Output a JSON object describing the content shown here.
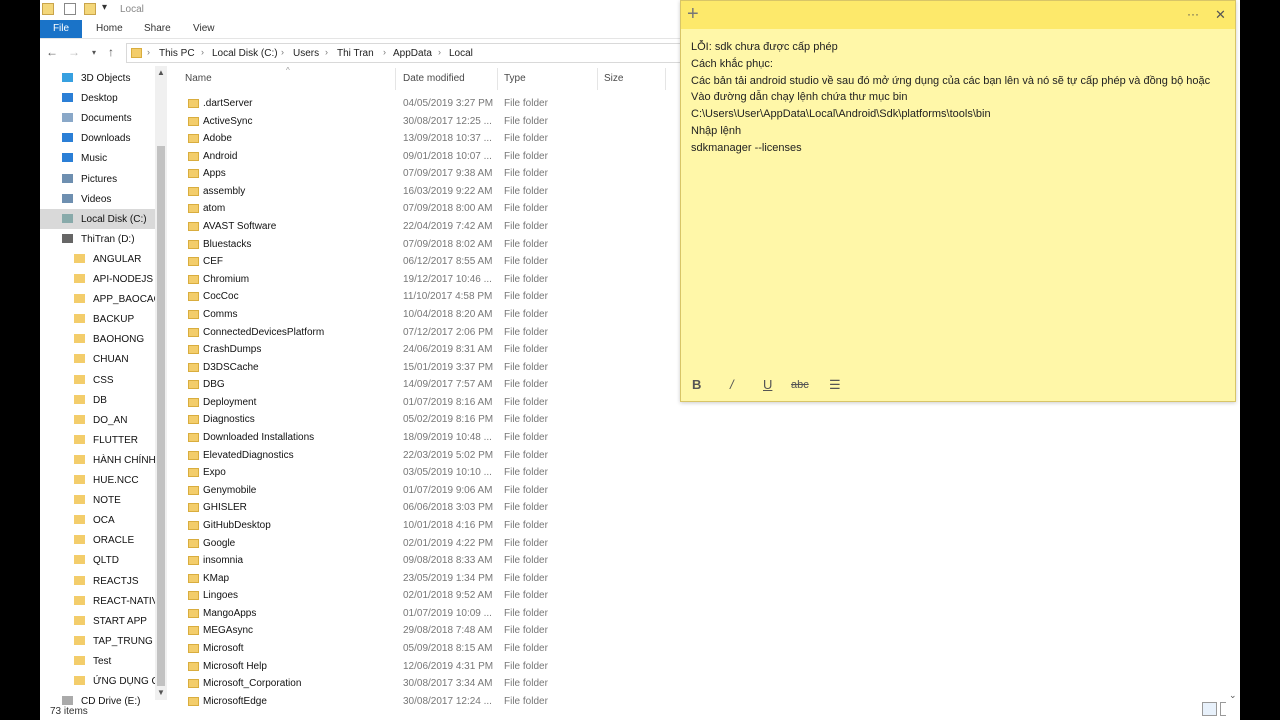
{
  "window": {
    "title": "Local"
  },
  "ribbon": {
    "tabs": [
      "File",
      "Home",
      "Share",
      "View"
    ]
  },
  "address": {
    "crumbs": [
      "This PC",
      "Local Disk (C:)",
      "Users",
      "Thi Tran",
      "AppData",
      "Local"
    ]
  },
  "nav": {
    "items": [
      {
        "label": "3D Objects",
        "icon": "cube-icon",
        "color": "#37a0e0"
      },
      {
        "label": "Desktop",
        "icon": "desktop-icon",
        "color": "#2b7fd6"
      },
      {
        "label": "Documents",
        "icon": "document-icon",
        "color": "#8aa8c8"
      },
      {
        "label": "Downloads",
        "icon": "download-icon",
        "color": "#2b7fd6"
      },
      {
        "label": "Music",
        "icon": "music-icon",
        "color": "#2b7fd6"
      },
      {
        "label": "Pictures",
        "icon": "pictures-icon",
        "color": "#6e8fb0"
      },
      {
        "label": "Videos",
        "icon": "video-icon",
        "color": "#6e8fb0"
      },
      {
        "label": "Local Disk (C:)",
        "icon": "drive-icon",
        "color": "#8aa"
      },
      {
        "label": "ThiTran (D:)",
        "icon": "drive-icon",
        "color": "#666"
      },
      {
        "label": "ANGULAR",
        "icon": "folder-icon",
        "color": "#f3cd6b"
      },
      {
        "label": "API-NODEJS",
        "icon": "folder-icon",
        "color": "#f3cd6b"
      },
      {
        "label": "APP_BAOCAO",
        "icon": "folder-icon",
        "color": "#f3cd6b"
      },
      {
        "label": "BACKUP",
        "icon": "folder-icon",
        "color": "#f3cd6b"
      },
      {
        "label": "BAOHONG",
        "icon": "folder-icon",
        "color": "#f3cd6b"
      },
      {
        "label": "CHUAN",
        "icon": "folder-icon",
        "color": "#f3cd6b"
      },
      {
        "label": "CSS",
        "icon": "folder-icon",
        "color": "#f3cd6b"
      },
      {
        "label": "DB",
        "icon": "folder-icon",
        "color": "#f3cd6b"
      },
      {
        "label": "DO_AN",
        "icon": "folder-icon",
        "color": "#f3cd6b"
      },
      {
        "label": "FLUTTER",
        "icon": "folder-icon",
        "color": "#f3cd6b"
      },
      {
        "label": "HÀNH CHÍNH",
        "icon": "folder-icon",
        "color": "#f3cd6b"
      },
      {
        "label": "HUE.NCC",
        "icon": "folder-icon",
        "color": "#f3cd6b"
      },
      {
        "label": "NOTE",
        "icon": "folder-icon",
        "color": "#f3cd6b"
      },
      {
        "label": "OCA",
        "icon": "folder-icon",
        "color": "#f3cd6b"
      },
      {
        "label": "ORACLE",
        "icon": "folder-icon",
        "color": "#f3cd6b"
      },
      {
        "label": "QLTD",
        "icon": "folder-icon",
        "color": "#f3cd6b"
      },
      {
        "label": "REACTJS",
        "icon": "folder-icon",
        "color": "#f3cd6b"
      },
      {
        "label": "REACT-NATIVE",
        "icon": "folder-icon",
        "color": "#f3cd6b"
      },
      {
        "label": "START APP",
        "icon": "folder-icon",
        "color": "#f3cd6b"
      },
      {
        "label": "TAP_TRUNG",
        "icon": "folder-icon",
        "color": "#f3cd6b"
      },
      {
        "label": "Test",
        "icon": "folder-icon",
        "color": "#f3cd6b"
      },
      {
        "label": "ỨNG DỤNG C#",
        "icon": "folder-icon",
        "color": "#f3cd6b"
      },
      {
        "label": "CD Drive (E:)",
        "icon": "cd-icon",
        "color": "#aaa"
      }
    ]
  },
  "columns": [
    "Name",
    "Date modified",
    "Type",
    "Size"
  ],
  "files": [
    {
      "name": ".dartServer",
      "date": "04/05/2019 3:27 PM",
      "type": "File folder"
    },
    {
      "name": "ActiveSync",
      "date": "30/08/2017 12:25 ...",
      "type": "File folder"
    },
    {
      "name": "Adobe",
      "date": "13/09/2018 10:37 ...",
      "type": "File folder"
    },
    {
      "name": "Android",
      "date": "09/01/2018 10:07 ...",
      "type": "File folder"
    },
    {
      "name": "Apps",
      "date": "07/09/2017 9:38 AM",
      "type": "File folder"
    },
    {
      "name": "assembly",
      "date": "16/03/2019 9:22 AM",
      "type": "File folder"
    },
    {
      "name": "atom",
      "date": "07/09/2018 8:00 AM",
      "type": "File folder"
    },
    {
      "name": "AVAST Software",
      "date": "22/04/2019 7:42 AM",
      "type": "File folder"
    },
    {
      "name": "Bluestacks",
      "date": "07/09/2018 8:02 AM",
      "type": "File folder"
    },
    {
      "name": "CEF",
      "date": "06/12/2017 8:55 AM",
      "type": "File folder"
    },
    {
      "name": "Chromium",
      "date": "19/12/2017 10:46 ...",
      "type": "File folder"
    },
    {
      "name": "CocCoc",
      "date": "11/10/2017 4:58 PM",
      "type": "File folder"
    },
    {
      "name": "Comms",
      "date": "10/04/2018 8:20 AM",
      "type": "File folder"
    },
    {
      "name": "ConnectedDevicesPlatform",
      "date": "07/12/2017 2:06 PM",
      "type": "File folder"
    },
    {
      "name": "CrashDumps",
      "date": "24/06/2019 8:31 AM",
      "type": "File folder"
    },
    {
      "name": "D3DSCache",
      "date": "15/01/2019 3:37 PM",
      "type": "File folder"
    },
    {
      "name": "DBG",
      "date": "14/09/2017 7:57 AM",
      "type": "File folder"
    },
    {
      "name": "Deployment",
      "date": "01/07/2019 8:16 AM",
      "type": "File folder"
    },
    {
      "name": "Diagnostics",
      "date": "05/02/2019 8:16 PM",
      "type": "File folder"
    },
    {
      "name": "Downloaded Installations",
      "date": "18/09/2019 10:48 ...",
      "type": "File folder"
    },
    {
      "name": "ElevatedDiagnostics",
      "date": "22/03/2019 5:02 PM",
      "type": "File folder"
    },
    {
      "name": "Expo",
      "date": "03/05/2019 10:10 ...",
      "type": "File folder"
    },
    {
      "name": "Genymobile",
      "date": "01/07/2019 9:06 AM",
      "type": "File folder"
    },
    {
      "name": "GHISLER",
      "date": "06/06/2018 3:03 PM",
      "type": "File folder"
    },
    {
      "name": "GitHubDesktop",
      "date": "10/01/2018 4:16 PM",
      "type": "File folder"
    },
    {
      "name": "Google",
      "date": "02/01/2019 4:22 PM",
      "type": "File folder"
    },
    {
      "name": "insomnia",
      "date": "09/08/2018 8:33 AM",
      "type": "File folder"
    },
    {
      "name": "KMap",
      "date": "23/05/2019 1:34 PM",
      "type": "File folder"
    },
    {
      "name": "Lingoes",
      "date": "02/01/2018 9:52 AM",
      "type": "File folder"
    },
    {
      "name": "MangoApps",
      "date": "01/07/2019 10:09 ...",
      "type": "File folder"
    },
    {
      "name": "MEGAsync",
      "date": "29/08/2018 7:48 AM",
      "type": "File folder"
    },
    {
      "name": "Microsoft",
      "date": "05/09/2018 8:15 AM",
      "type": "File folder"
    },
    {
      "name": "Microsoft Help",
      "date": "12/06/2019 4:31 PM",
      "type": "File folder"
    },
    {
      "name": "Microsoft_Corporation",
      "date": "30/08/2017 3:34 AM",
      "type": "File folder"
    },
    {
      "name": "MicrosoftEdge",
      "date": "30/08/2017 12:24 ...",
      "type": "File folder"
    }
  ],
  "status": {
    "count": "73 items"
  },
  "note": {
    "lines": [
      "LỖI: sdk chưa được cấp phép",
      "Cách khắc phục:",
      "Các bản tải android studio về sau đó mở ứng dụng của các bạn lên và nó sẽ tự cấp phép và đồng bộ hoặc",
      "Vào đường dẫn chạy lệnh chứa thư mục bin",
      "C:\\Users\\User\\AppData\\Local\\Android\\Sdk\\platforms\\tools\\bin",
      "Nhập lệnh",
      "sdkmanager --licenses"
    ],
    "toolbar": [
      "B",
      "/",
      "U",
      "abc",
      "☰"
    ],
    "add": "+",
    "more": "···",
    "close": "✕"
  }
}
